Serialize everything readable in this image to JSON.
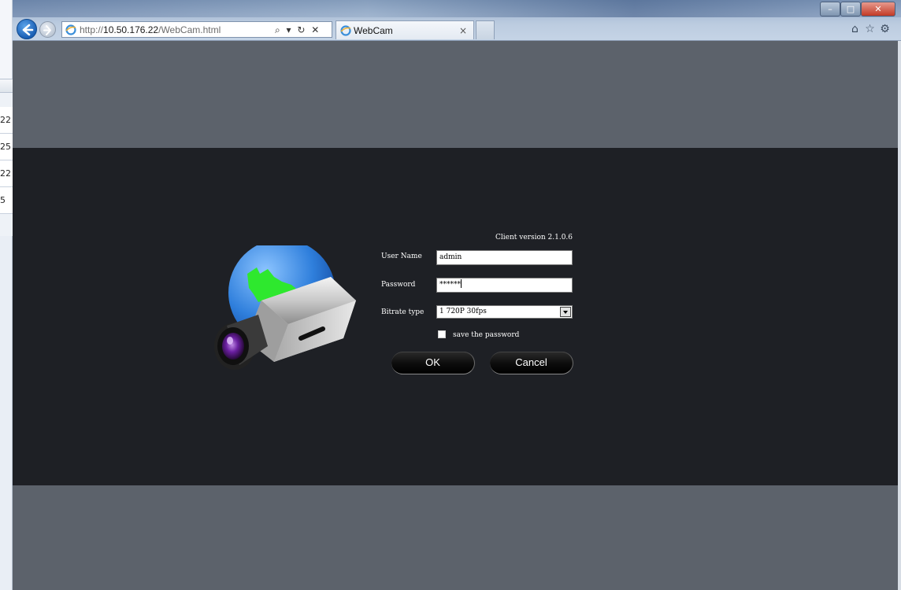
{
  "background_window": {
    "cells": [
      "22",
      "25",
      "22",
      "5"
    ]
  },
  "browser": {
    "address": {
      "prefix": "http://",
      "host": "10.50.176.22",
      "path": "/WebCam.html"
    },
    "address_tools": "⌕ ▾ ↻ ✕",
    "tab": {
      "title": "WebCam",
      "close": "×"
    },
    "window_buttons": {
      "minimize": "–",
      "maximize": "□",
      "close": "✕"
    },
    "toolbar_icons": [
      "home-icon",
      "star-icon",
      "gear-icon"
    ],
    "toolbar_glyphs": [
      "⌂",
      "☆",
      "⚙"
    ]
  },
  "login": {
    "client_version": "Client version 2.1.0.6",
    "user_name_label": "User Name",
    "user_name_value": "admin",
    "password_label": "Password",
    "password_value": "******",
    "bitrate_label": "Bitrate type",
    "bitrate_value": "1 720P 30fps",
    "save_password_label": "save the password",
    "save_password_checked": false,
    "ok_label": "OK",
    "cancel_label": "Cancel"
  },
  "colors": {
    "panel_background": "#1e2025",
    "page_background": "#5c626b",
    "globe_blue": "#2f7fdc",
    "map_green": "#2ee82e"
  }
}
